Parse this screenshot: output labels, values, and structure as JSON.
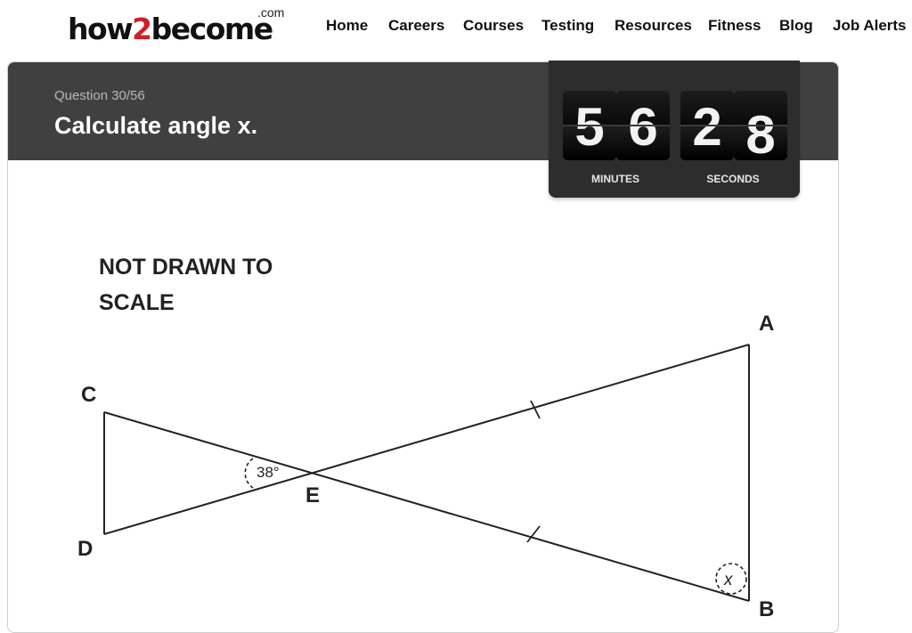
{
  "site": {
    "logo_text_a": "how",
    "logo_text_2": "2",
    "logo_text_b": "become",
    "logo_dotcom": ".com",
    "accent_color": "#d01f2a"
  },
  "nav": {
    "items": [
      "Home",
      "Careers",
      "Courses",
      "Testing",
      "Resources",
      "Fitness",
      "Blog",
      "Job Alerts"
    ]
  },
  "question": {
    "counter": "Question 30/56",
    "title": "Calculate angle x."
  },
  "timer": {
    "minutes": [
      "5",
      "6"
    ],
    "seconds": [
      "2",
      "8"
    ],
    "minutes_label": "MINUTES",
    "seconds_label": "SECONDS"
  },
  "diagram": {
    "note_line1": "NOT DRAWN TO",
    "note_line2": "SCALE",
    "vertex_a": "A",
    "vertex_b": "B",
    "vertex_c": "C",
    "vertex_d": "D",
    "vertex_e": "E",
    "angle_e": "38°",
    "angle_b": "x"
  },
  "colors": {
    "header_bg": "#404040",
    "timer_bg": "#2d2d2d"
  }
}
